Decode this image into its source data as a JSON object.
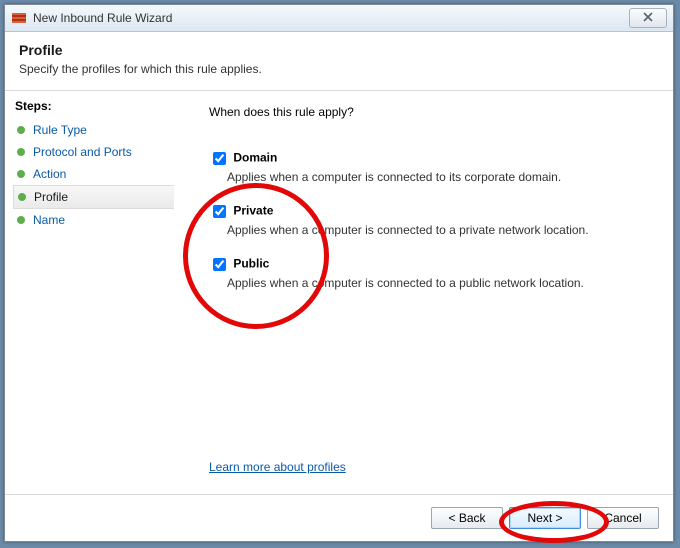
{
  "window": {
    "title": "New Inbound Rule Wizard"
  },
  "header": {
    "title": "Profile",
    "description": "Specify the profiles for which this rule applies."
  },
  "sidebar": {
    "heading": "Steps:",
    "items": [
      {
        "label": "Rule Type"
      },
      {
        "label": "Protocol and Ports"
      },
      {
        "label": "Action"
      },
      {
        "label": "Profile"
      },
      {
        "label": "Name"
      }
    ],
    "current_index": 3
  },
  "main": {
    "question": "When does this rule apply?",
    "options": [
      {
        "label": "Domain",
        "checked": true,
        "description": "Applies when a computer is connected to its corporate domain."
      },
      {
        "label": "Private",
        "checked": true,
        "description": "Applies when a computer is connected to a private network location."
      },
      {
        "label": "Public",
        "checked": true,
        "description": "Applies when a computer is connected to a public network location."
      }
    ],
    "learn_more": "Learn more about profiles"
  },
  "footer": {
    "back": "< Back",
    "next": "Next >",
    "cancel": "Cancel"
  }
}
